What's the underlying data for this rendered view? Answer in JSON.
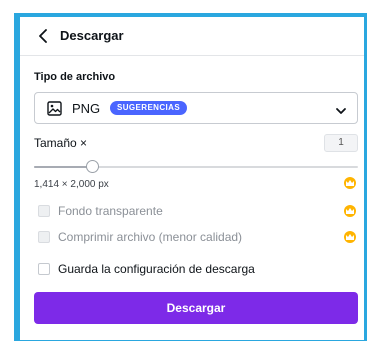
{
  "header": {
    "title": "Descargar"
  },
  "file_type": {
    "label": "Tipo de archivo",
    "selected": "PNG",
    "badge": "SUGERENCIAS"
  },
  "size": {
    "label": "Tamaño ×",
    "value": "1",
    "slider_fraction": 0.18,
    "dimensions": "1,414 × 2,000 px"
  },
  "options": {
    "transparent": "Fondo transparente",
    "compress": "Comprimir archivo (menor calidad)",
    "save_settings": "Guarda la configuración de descarga"
  },
  "download_button": "Descargar",
  "colors": {
    "accent": "#7d2ae8",
    "badge": "#4a65ff",
    "premium": "#ffb400",
    "frame": "#2aa7df"
  }
}
